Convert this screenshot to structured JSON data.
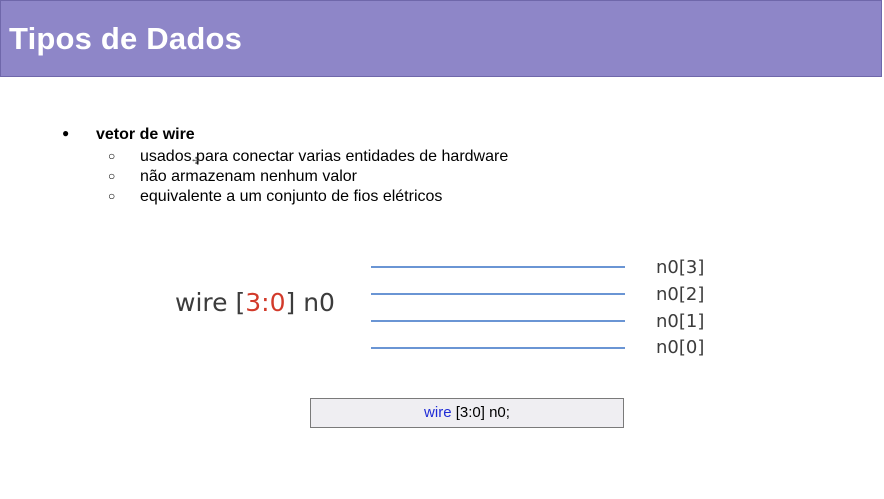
{
  "slide": {
    "title": "Tipos de Dados",
    "bullet": {
      "marker": "●",
      "label": "vetor de wire",
      "sub_marker": "○",
      "items": [
        "usados para conectar varias entidades de hardware",
        "não armazenam nenhum valor",
        "equivalente a um conjunto de fios elétricos"
      ]
    },
    "diagram": {
      "decl_keyword": "wire",
      "decl_range_open": "[",
      "decl_range": "3:0",
      "decl_range_close": "]",
      "decl_name": "n0",
      "bits": [
        "n0[3]",
        "n0[2]",
        "n0[1]",
        "n0[0]"
      ],
      "line_color": "#6a95d4",
      "range_color": "#d23a2a"
    },
    "code": {
      "keyword": "wire",
      "rest": " [3:0] n0;"
    },
    "colors": {
      "title_bar": "#8e86c8",
      "keyword": "#1f2bd6"
    }
  }
}
